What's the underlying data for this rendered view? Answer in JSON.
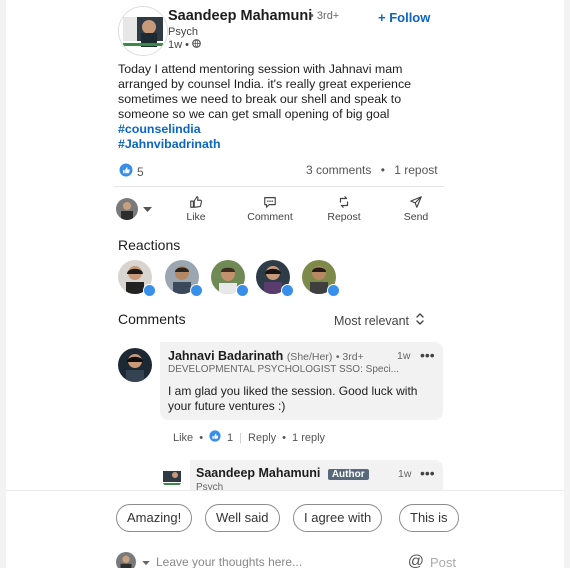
{
  "post": {
    "author": {
      "name": "Saandeep Mahamuni",
      "degree": "• 3rd+",
      "headline": "Psych",
      "time": "1w •"
    },
    "follow_label": "+ Follow",
    "text": "Today I attend mentoring session with Jahnavi mam arranged by counsel India. it's really great experience sometimes we need to break our shell and speak to someone so we can get small opening of big goal",
    "hashtags": [
      "#counselindia",
      "#Jahnvibadrinath"
    ],
    "reaction_count": "5",
    "comments_count": "3 comments",
    "reposts_count": "1 repost",
    "separator": "•"
  },
  "actions": {
    "like": "Like",
    "comment": "Comment",
    "repost": "Repost",
    "send": "Send"
  },
  "reactions": {
    "title": "Reactions"
  },
  "comments": {
    "title": "Comments",
    "sort_label": "Most relevant",
    "items": [
      {
        "name": "Jahnavi Badarinath",
        "pronouns": "(She/Her)",
        "degree": "• 3rd+",
        "time": "1w",
        "headline": "DEVELOPMENTAL PSYCHOLOGIST SSO: Speci...",
        "body": "I am glad you liked the session. Good luck with your future ventures :)",
        "like_label": "Like",
        "like_count": "1",
        "reply_label": "Reply",
        "reply_count": "1 reply"
      },
      {
        "name": "Saandeep Mahamuni",
        "badge": "Author",
        "time": "1w",
        "headline": "Psych"
      }
    ]
  },
  "suggestions": [
    "Amazing!",
    "Well said",
    "I agree with",
    "This is"
  ],
  "compose": {
    "placeholder": "Leave your thoughts here...",
    "post_label": "Post"
  }
}
